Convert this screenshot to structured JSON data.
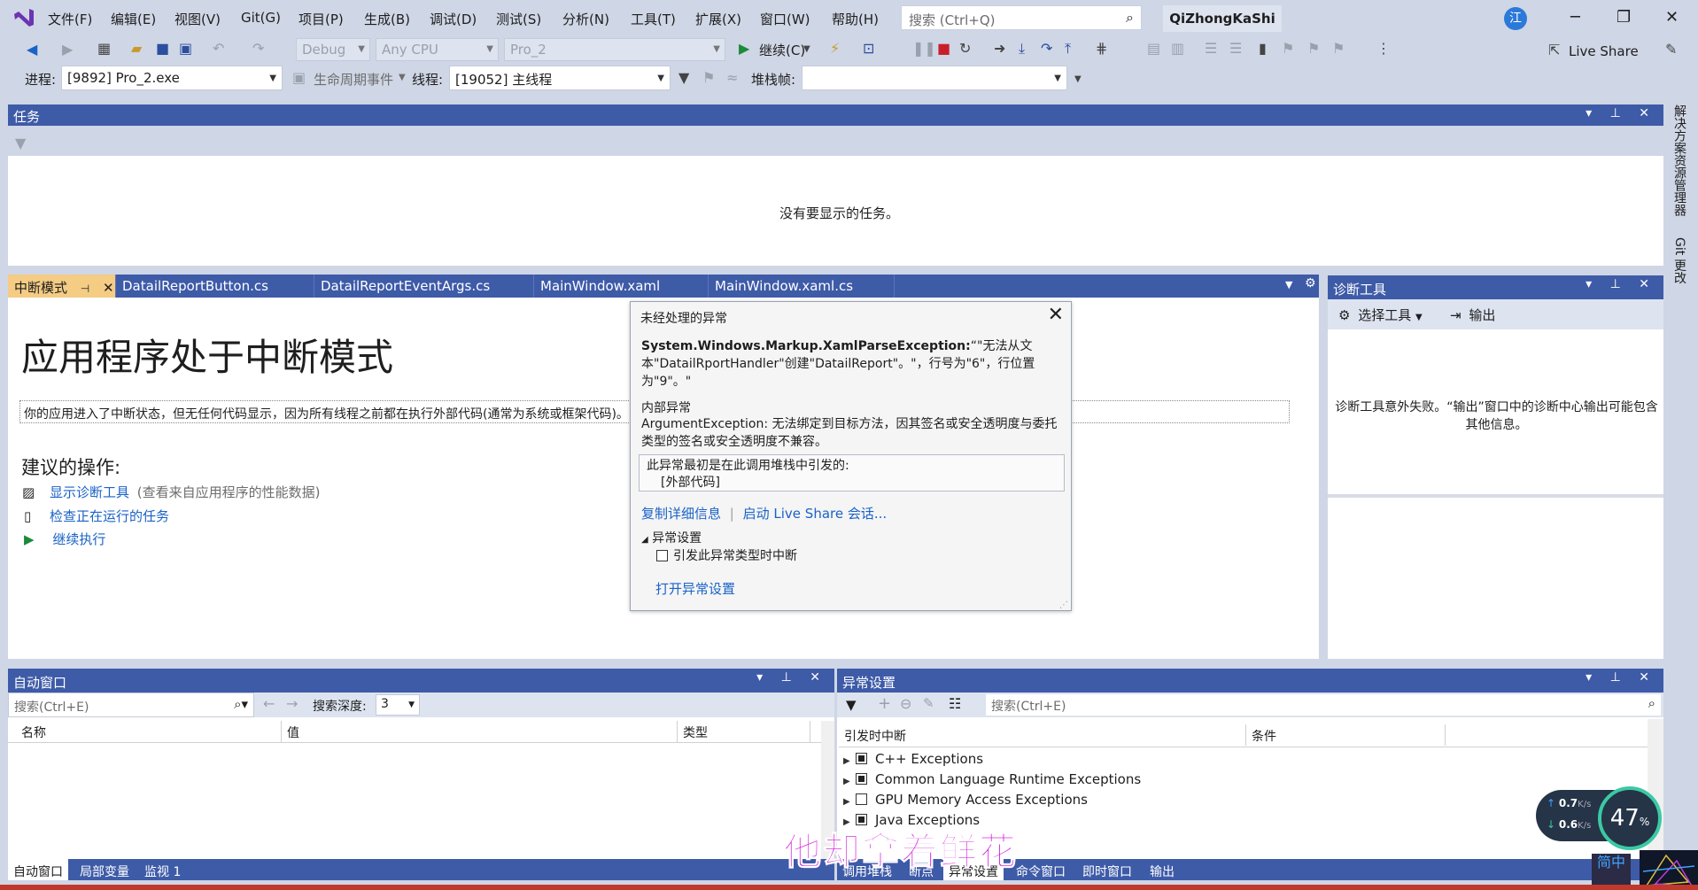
{
  "menubar": {
    "items": [
      "文件(F)",
      "编辑(E)",
      "视图(V)",
      "Git(G)",
      "项目(P)",
      "生成(B)",
      "调试(D)",
      "测试(S)",
      "分析(N)",
      "工具(T)",
      "扩展(X)",
      "窗口(W)",
      "帮助(H)"
    ],
    "search_placeholder": "搜索 (Ctrl+Q)",
    "app_title": "QiZhongKaShi",
    "avatar": "江"
  },
  "toolbar": {
    "config": "Debug",
    "platform": "Any CPU",
    "project": "Pro_2",
    "continue_label": "继续(C)",
    "liveshare": "Live Share"
  },
  "debugbar": {
    "process_label": "进程:",
    "process_value": "[9892] Pro_2.exe",
    "lifecycle": "生命周期事件",
    "thread_label": "线程:",
    "thread_value": "[19052] 主线程",
    "stack_label": "堆栈帧:"
  },
  "tasks": {
    "title": "任务",
    "empty": "没有要显示的任务。"
  },
  "doc_tabs": [
    "中断模式",
    "DatailReportButton.cs",
    "DatailReportEventArgs.cs",
    "MainWindow.xaml",
    "MainWindow.xaml.cs"
  ],
  "breakmode": {
    "heading": "应用程序处于中断模式",
    "note": "你的应用进入了中断状态，但无任何代码显示，因为所有线程之前都在执行外部代码(通常为系统或框架代码)。",
    "suggest_title": "建议的操作:",
    "action1": "显示诊断工具",
    "action1_hint": "(查看来自应用程序的性能数据)",
    "action2": "检查正在运行的任务",
    "action3": "继续执行"
  },
  "exception": {
    "title": "未经处理的异常",
    "type": "System.Windows.Markup.XamlParseException:",
    "message": "“\"无法从文本\"DatailRportHandler\"创建\"DatailReport\"。\"，行号为\"6\"，行位置为\"9\"。\"",
    "inner_title": "内部异常",
    "inner_message": "ArgumentException: 无法绑定到目标方法，因其签名或安全透明度与委托类型的签名或安全透明度不兼容。",
    "stack_title": "此异常最初是在此调用堆栈中引发的:",
    "stack_item": "[外部代码]",
    "copy_details": "复制详细信息",
    "start_liveshare": "启动 Live Share 会话...",
    "settings_title": "异常设置",
    "break_checkbox": "引发此异常类型时中断",
    "open_settings": "打开异常设置"
  },
  "diag": {
    "title": "诊断工具",
    "select_tools": "选择工具",
    "output": "输出",
    "message": "诊断工具意外失败。“输出”窗口中的诊断中心输出可能包含其他信息。"
  },
  "side_tabs": [
    "解决方案资源管理器",
    "Git 更改"
  ],
  "auto": {
    "title": "自动窗口",
    "search_placeholder": "搜索(Ctrl+E)",
    "depth_label": "搜索深度:",
    "depth_value": "3",
    "columns": [
      "名称",
      "值",
      "类型"
    ],
    "tabs": [
      "自动窗口",
      "局部变量",
      "监视 1"
    ]
  },
  "exc_settings": {
    "title": "异常设置",
    "search_placeholder": "搜索(Ctrl+E)",
    "columns": [
      "引发时中断",
      "条件"
    ],
    "rows": [
      {
        "label": "C++ Exceptions",
        "checked": true
      },
      {
        "label": "Common Language Runtime Exceptions",
        "checked": true
      },
      {
        "label": "GPU Memory Access Exceptions",
        "checked": false
      },
      {
        "label": "Java Exceptions",
        "checked": true
      }
    ],
    "tabs": [
      "调用堆栈",
      "断点",
      "异常设置",
      "命令窗口",
      "即时窗口",
      "输出"
    ]
  },
  "overlay": {
    "subtitle": "他却拿着鲜花",
    "net_up": "0.7",
    "net_down": "0.6",
    "net_unit": "K/s",
    "cpu": "47",
    "cpu_unit": "%",
    "ime": "简中"
  },
  "colors": {
    "chrome": "#cfd6e5",
    "panel_header": "#3e5ba8",
    "active_tab": "#f5cc84",
    "link": "#1a62c7",
    "subtitle": "#d21ddc"
  }
}
